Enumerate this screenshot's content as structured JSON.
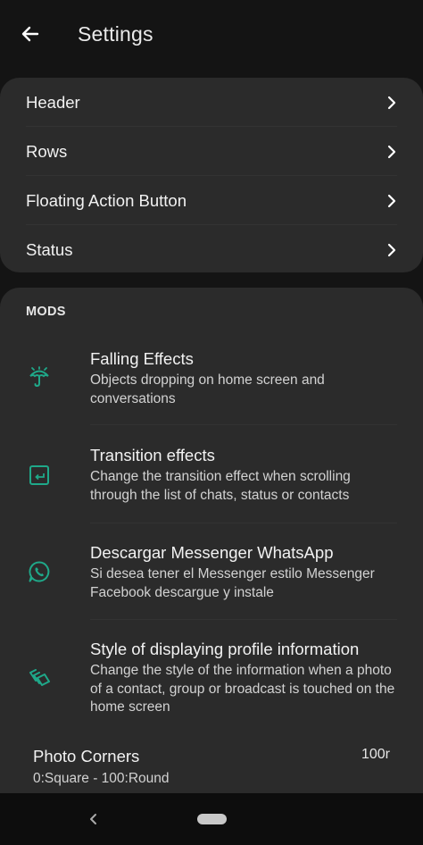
{
  "appbar": {
    "title": "Settings"
  },
  "settings_list": [
    {
      "label": "Header"
    },
    {
      "label": "Rows"
    },
    {
      "label": "Floating Action Button"
    },
    {
      "label": "Status"
    }
  ],
  "mods": {
    "section_title": "MODS",
    "items": [
      {
        "title": "Falling Effects",
        "desc": "Objects dropping on home screen and conversations",
        "icon": "umbrella-icon"
      },
      {
        "title": "Transition effects",
        "desc": "Change the transition effect when scrolling through the list of chats, status or contacts",
        "icon": "transition-icon"
      },
      {
        "title": "Descargar Messenger WhatsApp",
        "desc": "Si desea tener el Messenger estilo Messenger Facebook descargue y instale",
        "icon": "whatsapp-icon"
      },
      {
        "title": "Style of displaying profile information",
        "desc": "Change the style of the information when a photo of a contact, group or broadcast is touched on the home screen",
        "icon": "layers-icon"
      }
    ]
  },
  "photo_corners": {
    "title": "Photo Corners",
    "subtitle": "0:Square - 100:Round",
    "value": "100r"
  },
  "colors": {
    "background": "#141414",
    "card": "#2b2b2b",
    "accent": "#1fa889",
    "text": "#f2f2f2"
  }
}
